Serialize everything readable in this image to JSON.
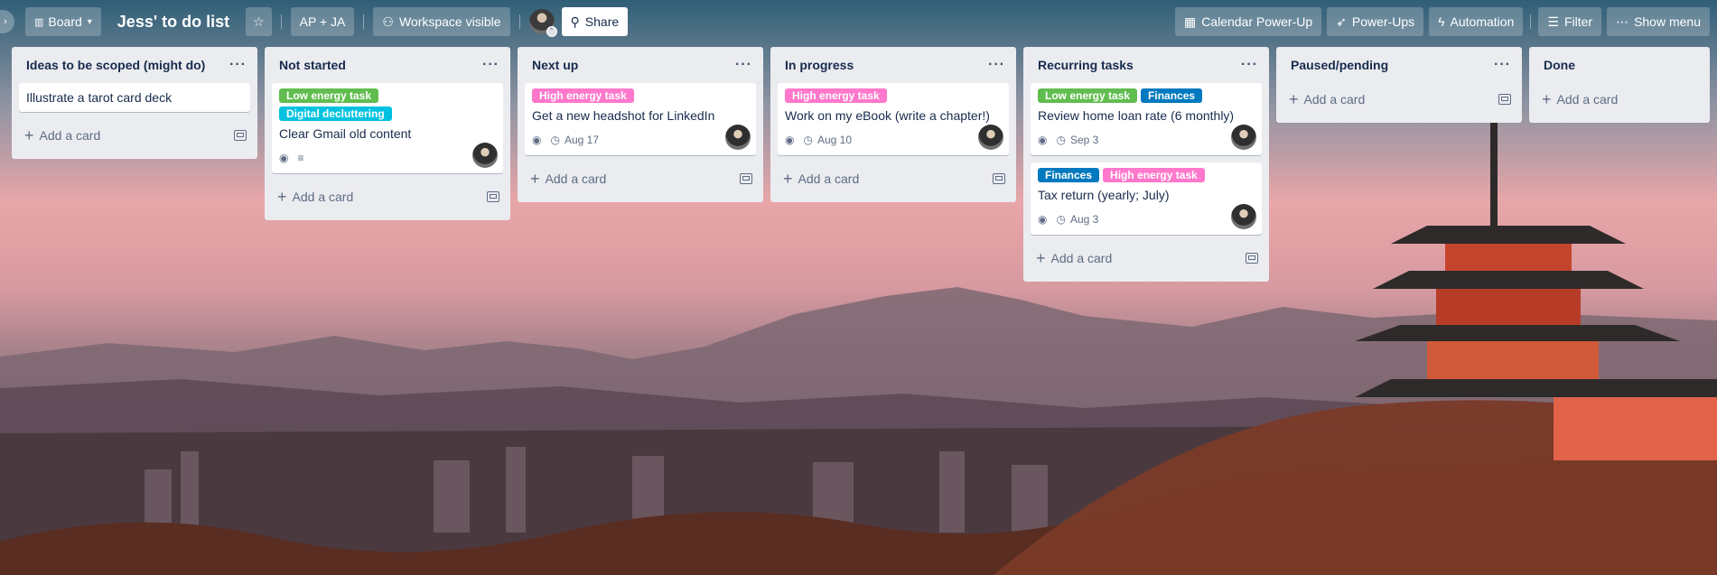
{
  "header": {
    "view_label": "Board",
    "board_title": "Jess' to do list",
    "members_label": "AP + JA",
    "visibility_label": "Workspace visible",
    "share_label": "Share",
    "calendar_label": "Calendar Power-Up",
    "powerups_label": "Power-Ups",
    "automation_label": "Automation",
    "filter_label": "Filter",
    "menu_label": "Show menu"
  },
  "colors": {
    "green": "#61bd4f",
    "teal": "#00c2e0",
    "pink": "#ff78cb",
    "blue": "#0079bf"
  },
  "add_card_label": "Add a card",
  "lists": [
    {
      "title": "Ideas to be scoped (might do)",
      "cards": [
        {
          "title": "Illustrate a tarot card deck"
        }
      ]
    },
    {
      "title": "Not started",
      "cards": [
        {
          "labels": [
            "Low energy task",
            "Digital decluttering"
          ],
          "title": "Clear Gmail old content"
        }
      ]
    },
    {
      "title": "Next up",
      "cards": [
        {
          "labels": [
            "High energy task"
          ],
          "title": "Get a new headshot for LinkedIn",
          "due": "Aug 17"
        }
      ]
    },
    {
      "title": "In progress",
      "cards": [
        {
          "labels": [
            "High energy task"
          ],
          "title": "Work on my eBook (write a chapter!)",
          "due": "Aug 10"
        }
      ]
    },
    {
      "title": "Recurring tasks",
      "cards": [
        {
          "labels": [
            "Low energy task",
            "Finances"
          ],
          "title": "Review home loan rate (6 monthly)",
          "due": "Sep 3"
        },
        {
          "labels": [
            "Finances",
            "High energy task"
          ],
          "title": "Tax return (yearly; July)",
          "due": "Aug 3"
        }
      ]
    },
    {
      "title": "Paused/pending",
      "cards": []
    },
    {
      "title": "Done",
      "cards": []
    }
  ]
}
